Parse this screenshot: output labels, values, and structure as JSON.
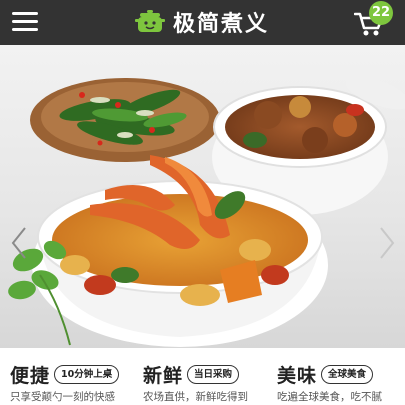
{
  "header": {
    "brand_name": "极简煮义",
    "cart_count": "22",
    "menu_icon": "hamburger-menu-icon",
    "cart_icon": "shopping-cart-icon",
    "logo_icon": "cooking-pot-icon",
    "colors": {
      "bar": "#333333",
      "badge": "#7ec63e",
      "logo_pot": "#7ec63e"
    }
  },
  "banner": {
    "image": "food-photo-shrimp-curry-and-stew",
    "prev_icon": "chevron-left-icon",
    "next_icon": "chevron-right-icon"
  },
  "features": [
    {
      "title": "便捷",
      "tag": "10分钟上桌",
      "desc": "只享受颠勺一刻的快感"
    },
    {
      "title": "新鲜",
      "tag": "当日采购",
      "desc": "农场直供，新鲜吃得到"
    },
    {
      "title": "美味",
      "tag": "全球美食",
      "desc": "吃遍全球美食，吃不腻"
    }
  ]
}
